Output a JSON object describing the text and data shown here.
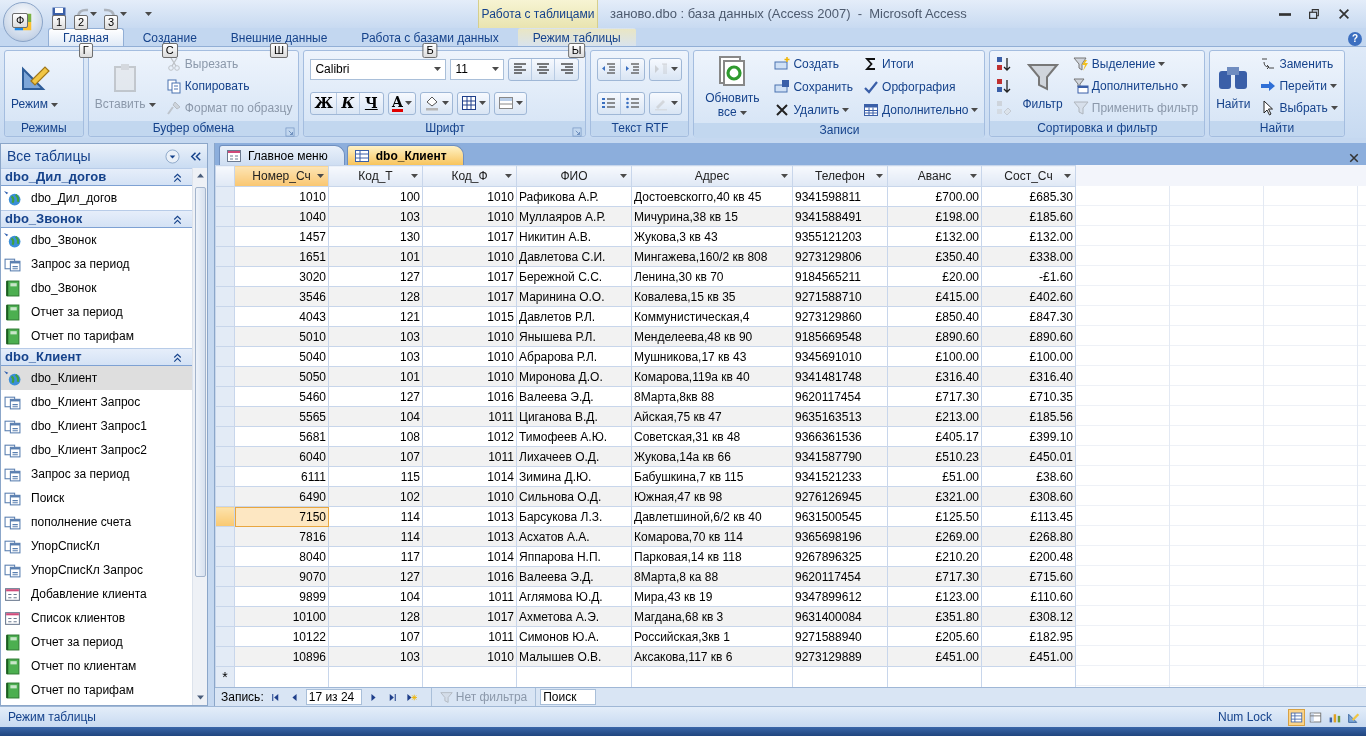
{
  "window": {
    "title": "заново.dbo : база данных (Access 2007)  -  Microsoft Access",
    "contextual_tab": "Работа с таблицами",
    "office_keytip": "Ф"
  },
  "quick_access": [
    {
      "keytip": "1",
      "disabled": false,
      "dropdown": false
    },
    {
      "keytip": "2",
      "disabled": true,
      "dropdown": true
    },
    {
      "keytip": "3",
      "disabled": true,
      "dropdown": true
    }
  ],
  "ribbon_tabs": [
    {
      "label": "Главная",
      "keytip": "Г",
      "selected": true,
      "contextual": false
    },
    {
      "label": "Создание",
      "keytip": "С",
      "selected": false,
      "contextual": false
    },
    {
      "label": "Внешние данные",
      "keytip": "Ш",
      "selected": false,
      "contextual": false
    },
    {
      "label": "Работа с базами данных",
      "keytip": "Б",
      "selected": false,
      "contextual": false
    },
    {
      "label": "Режим таблицы",
      "keytip": "Ы",
      "selected": false,
      "contextual": true
    }
  ],
  "ribbon": {
    "help": "?",
    "groups": [
      {
        "label": "Режимы",
        "launcher": false,
        "columns": [
          [
            {
              "kind": "large",
              "label": "Режим",
              "dropdown": true,
              "disabled": false
            }
          ]
        ]
      },
      {
        "label": "Буфер обмена",
        "launcher": true,
        "columns": [
          [
            {
              "kind": "large",
              "label": "Вставить",
              "dropdown": true,
              "disabled": true
            }
          ],
          [
            {
              "kind": "small",
              "label": "Вырезать",
              "dropdown": false,
              "disabled": true
            },
            {
              "kind": "small",
              "label": "Копировать",
              "dropdown": false,
              "disabled": false
            },
            {
              "kind": "small",
              "label": "Формат по образцу",
              "dropdown": false,
              "disabled": true
            }
          ]
        ]
      },
      {
        "label": "Шрифт",
        "launcher": true,
        "rows": [
          [
            {
              "kind": "font-combo",
              "value": "Calibri"
            },
            {
              "kind": "size-combo",
              "value": "11"
            },
            {
              "kind": "segment",
              "buttons": [
                {
                  "dropdown": false,
                  "disabled": false
                },
                {
                  "dropdown": false,
                  "disabled": false
                },
                {
                  "dropdown": false,
                  "disabled": false
                }
              ]
            }
          ],
          [
            {
              "kind": "segment",
              "buttons": [
                {
                  "glyph": "Ж",
                  "dropdown": false,
                  "disabled": false
                },
                {
                  "glyph": "К",
                  "dropdown": false,
                  "disabled": false
                },
                {
                  "glyph": "Ч",
                  "dropdown": false,
                  "disabled": false
                }
              ]
            },
            {
              "kind": "segment",
              "buttons": [
                {
                  "glyph": "А",
                  "dropdown": true,
                  "disabled": false
                }
              ]
            },
            {
              "kind": "segment",
              "buttons": [
                {
                  "dropdown": true,
                  "disabled": false
                }
              ]
            },
            {
              "kind": "segment",
              "buttons": [
                {
                  "dropdown": true,
                  "disabled": false
                }
              ]
            },
            {
              "kind": "segment",
              "buttons": [
                {
                  "dropdown": true,
                  "disabled": false
                }
              ]
            }
          ]
        ]
      },
      {
        "label": "Текст RTF",
        "launcher": false,
        "rows": [
          [
            {
              "kind": "segment",
              "buttons": [
                {
                  "dropdown": false,
                  "disabled": false
                },
                {
                  "dropdown": false,
                  "disabled": false
                }
              ]
            },
            {
              "kind": "segment",
              "buttons": [
                {
                  "dropdown": true,
                  "disabled": true
                }
              ]
            }
          ],
          [
            {
              "kind": "segment",
              "buttons": [
                {
                  "dropdown": false,
                  "disabled": false
                },
                {
                  "dropdown": false,
                  "disabled": false
                }
              ]
            },
            {
              "kind": "segment",
              "buttons": [
                {
                  "dropdown": true,
                  "disabled": true
                }
              ]
            }
          ]
        ]
      },
      {
        "label": "Записи",
        "launcher": false,
        "columns": [
          [
            {
              "kind": "large",
              "label": "Обновить все",
              "dropdown": true,
              "disabled": false
            }
          ],
          [
            {
              "kind": "small",
              "label": "Создать",
              "dropdown": false,
              "disabled": false
            },
            {
              "kind": "small",
              "label": "Сохранить",
              "dropdown": false,
              "disabled": false
            },
            {
              "kind": "small",
              "label": "Удалить",
              "dropdown": true,
              "disabled": false
            }
          ],
          [
            {
              "kind": "small",
              "label": "Итоги",
              "dropdown": false,
              "disabled": false
            },
            {
              "kind": "small",
              "label": "Орфография",
              "dropdown": false,
              "disabled": false
            },
            {
              "kind": "small",
              "label": "Дополнительно",
              "dropdown": true,
              "disabled": false
            }
          ]
        ]
      },
      {
        "label": "Сортировка и фильтр",
        "launcher": false,
        "columns": [
          [
            {
              "kind": "icon",
              "disabled": false
            },
            {
              "kind": "icon",
              "disabled": false
            },
            {
              "kind": "icon",
              "disabled": true
            }
          ],
          [
            {
              "kind": "large",
              "label": "Фильтр",
              "dropdown": false,
              "disabled": false
            }
          ],
          [
            {
              "kind": "small",
              "label": "Выделение",
              "dropdown": true,
              "disabled": false
            },
            {
              "kind": "small",
              "label": "Дополнительно",
              "dropdown": true,
              "disabled": false
            },
            {
              "kind": "small",
              "label": "Применить фильтр",
              "dropdown": false,
              "disabled": true
            }
          ]
        ]
      },
      {
        "label": "Найти",
        "launcher": false,
        "columns": [
          [
            {
              "kind": "large",
              "label": "Найти",
              "dropdown": false,
              "disabled": false
            }
          ],
          [
            {
              "kind": "small",
              "label": "Заменить",
              "dropdown": false,
              "disabled": false
            },
            {
              "kind": "small",
              "label": "Перейти",
              "dropdown": true,
              "disabled": false
            },
            {
              "kind": "small",
              "label": "Выбрать",
              "dropdown": true,
              "disabled": false
            }
          ]
        ]
      }
    ]
  },
  "nav_pane": {
    "title": "Все таблицы",
    "groups": [
      {
        "title": "dbo_Дил_догов",
        "expanded": true,
        "items": [
          {
            "kind": "linked-table",
            "label": "dbo_Дил_догов",
            "selected": false
          }
        ]
      },
      {
        "title": "dbo_Звонок",
        "expanded": true,
        "items": [
          {
            "kind": "linked-table",
            "label": "dbo_Звонок",
            "selected": false
          },
          {
            "kind": "query",
            "label": "Запрос за период",
            "selected": false
          },
          {
            "kind": "report",
            "label": "dbo_Звонок",
            "selected": false
          },
          {
            "kind": "report",
            "label": "Отчет за период",
            "selected": false
          },
          {
            "kind": "report",
            "label": "Отчет по тарифам",
            "selected": false
          }
        ]
      },
      {
        "title": "dbo_Клиент",
        "expanded": true,
        "items": [
          {
            "kind": "linked-table",
            "label": "dbo_Клиент",
            "selected": true
          },
          {
            "kind": "query",
            "label": "dbo_Клиент Запрос",
            "selected": false
          },
          {
            "kind": "query",
            "label": "dbo_Клиент Запрос1",
            "selected": false
          },
          {
            "kind": "query",
            "label": "dbo_Клиент Запрос2",
            "selected": false
          },
          {
            "kind": "query",
            "label": "Запрос за период",
            "selected": false
          },
          {
            "kind": "query",
            "label": "Поиск",
            "selected": false
          },
          {
            "kind": "query",
            "label": "пополнение счета",
            "selected": false
          },
          {
            "kind": "query",
            "label": "УпорСписКл",
            "selected": false
          },
          {
            "kind": "query",
            "label": "УпорСписКл Запрос",
            "selected": false
          },
          {
            "kind": "form",
            "label": "Добавление клиента",
            "selected": false
          },
          {
            "kind": "form",
            "label": "Список клиентов",
            "selected": false
          },
          {
            "kind": "report",
            "label": "Отчет за период",
            "selected": false
          },
          {
            "kind": "report",
            "label": "Отчет по клиентам",
            "selected": false
          },
          {
            "kind": "report",
            "label": "Отчет по тарифам",
            "selected": false
          }
        ]
      }
    ]
  },
  "document_tabs": [
    {
      "kind": "form",
      "label": "Главное меню",
      "selected": false
    },
    {
      "kind": "table",
      "label": "dbo_Клиент",
      "selected": true
    }
  ],
  "table": {
    "columns": [
      {
        "label": "Номер_Сч",
        "selected": true
      },
      {
        "label": "Код_Т",
        "selected": false
      },
      {
        "label": "Код_Ф",
        "selected": false
      },
      {
        "label": "ФИО",
        "selected": false
      },
      {
        "label": "Адрес",
        "selected": false
      },
      {
        "label": "Телефон",
        "selected": false
      },
      {
        "label": "Аванс",
        "selected": false
      },
      {
        "label": "Сост_Сч",
        "selected": false
      }
    ],
    "rows": [
      {
        "selected": false,
        "cells": [
          "1010",
          "100",
          "1010",
          "Рафикова А.Р.",
          "Достоевскогго,40 кв 45",
          "9341598811",
          "£700.00",
          "£685.30"
        ]
      },
      {
        "selected": false,
        "cells": [
          "1040",
          "103",
          "1010",
          "Муллаяров А.Р.",
          "Мичурина,38 кв 15",
          "9341588491",
          "£198.00",
          "£185.60"
        ]
      },
      {
        "selected": false,
        "cells": [
          "1457",
          "130",
          "1017",
          "Никитин А.В.",
          "Жукова,3 кв 43",
          "9355121203",
          "£132.00",
          "£132.00"
        ]
      },
      {
        "selected": false,
        "cells": [
          "1651",
          "101",
          "1010",
          "Давлетова С.И.",
          "Мингажева,160/2 кв 808",
          "9273129806",
          "£350.40",
          "£338.00"
        ]
      },
      {
        "selected": false,
        "cells": [
          "3020",
          "127",
          "1017",
          "Бережной С.С.",
          "Ленина,30 кв 70",
          "9184565211",
          "£20.00",
          "-£1.60"
        ]
      },
      {
        "selected": false,
        "cells": [
          "3546",
          "128",
          "1017",
          "Маринина О.О.",
          "Ковалева,15 кв 35",
          "9271588710",
          "£415.00",
          "£402.60"
        ]
      },
      {
        "selected": false,
        "cells": [
          "4043",
          "121",
          "1015",
          "Давлетов Р.Л.",
          "Коммунистическая,4",
          "9273129860",
          "£850.40",
          "£847.30"
        ]
      },
      {
        "selected": false,
        "cells": [
          "5010",
          "103",
          "1010",
          "Янышева Р.Л.",
          "Менделеева,48 кв 90",
          "9185669548",
          "£890.60",
          "£890.60"
        ]
      },
      {
        "selected": false,
        "cells": [
          "5040",
          "103",
          "1010",
          "Абрарова Р.Л.",
          "Мушникова,17 кв 43",
          "9345691010",
          "£100.00",
          "£100.00"
        ]
      },
      {
        "selected": false,
        "cells": [
          "5050",
          "101",
          "1010",
          "Миронова Д.О.",
          "Комарова,119а кв 40",
          "9341481748",
          "£316.40",
          "£316.40"
        ]
      },
      {
        "selected": false,
        "cells": [
          "5460",
          "127",
          "1016",
          "Валеева Э.Д.",
          "8Марта,8кв 88",
          "9620117454",
          "£717.30",
          "£710.35"
        ]
      },
      {
        "selected": false,
        "cells": [
          "5565",
          "104",
          "1011",
          "Циганова В.Д.",
          "Айская,75 кв 47",
          "9635163513",
          "£213.00",
          "£185.56"
        ]
      },
      {
        "selected": false,
        "cells": [
          "5681",
          "108",
          "1012",
          "Тимофеев А.Ю.",
          "Советская,31 кв 48",
          "9366361536",
          "£405.17",
          "£399.10"
        ]
      },
      {
        "selected": false,
        "cells": [
          "6040",
          "107",
          "1011",
          "Лихачеев О.Д.",
          "Жукова,14а кв 66",
          "9341587790",
          "£510.23",
          "£450.01"
        ]
      },
      {
        "selected": false,
        "cells": [
          "6111",
          "115",
          "1014",
          "Зимина Д.Ю.",
          "Бабушкина,7 кв 115",
          "9341521233",
          "£51.00",
          "£38.60"
        ]
      },
      {
        "selected": false,
        "cells": [
          "6490",
          "102",
          "1010",
          "Сильнова О.Д.",
          "Южная,47 кв 98",
          "9276126945",
          "£321.00",
          "£308.60"
        ]
      },
      {
        "selected": true,
        "cells": [
          "7150",
          "114",
          "1013",
          "Барсукова Л.З.",
          "Давлетшиной,6/2 кв 40",
          "9631500545",
          "£125.50",
          "£113.45"
        ]
      },
      {
        "selected": false,
        "cells": [
          "7816",
          "114",
          "1013",
          "Асхатов А.А.",
          "Комарова,70 кв 114",
          "9365698196",
          "£269.00",
          "£268.80"
        ]
      },
      {
        "selected": false,
        "cells": [
          "8040",
          "117",
          "1014",
          "Яппарова Н.П.",
          "Парковая,14 кв 118",
          "9267896325",
          "£210.20",
          "£200.48"
        ]
      },
      {
        "selected": false,
        "cells": [
          "9070",
          "127",
          "1016",
          "Валеева Э.Д.",
          "8Марта,8 ка 88",
          "9620117454",
          "£717.30",
          "£715.60"
        ]
      },
      {
        "selected": false,
        "cells": [
          "9899",
          "104",
          "1011",
          "Аглямова Ю.Д.",
          "Мира,43 кв 19",
          "9347899612",
          "£123.00",
          "£110.60"
        ]
      },
      {
        "selected": false,
        "cells": [
          "10100",
          "128",
          "1017",
          "Ахметова А.Э.",
          "Магдана,68 кв 3",
          "9631400084",
          "£351.80",
          "£308.12"
        ]
      },
      {
        "selected": false,
        "cells": [
          "10122",
          "107",
          "1011",
          "Симонов Ю.А.",
          "Российская,3кв 1",
          "9271588940",
          "£205.60",
          "£182.95"
        ]
      },
      {
        "selected": false,
        "cells": [
          "10896",
          "103",
          "1010",
          "Малышев О.В.",
          "Аксакова,117 кв 6",
          "9273129889",
          "£451.00",
          "£451.00"
        ]
      }
    ],
    "new_row_marker": "*"
  },
  "record_nav": {
    "label": "Запись:",
    "position": "17 из 24",
    "filter": {
      "label": "Нет фильтра",
      "disabled": true
    },
    "search": {
      "placeholder": "Поиск"
    }
  },
  "status_bar": {
    "text": "Режим таблицы",
    "indicator": "Num Lock",
    "views": [
      {
        "selected": true
      },
      {
        "selected": false
      },
      {
        "selected": false
      },
      {
        "selected": false
      }
    ]
  }
}
